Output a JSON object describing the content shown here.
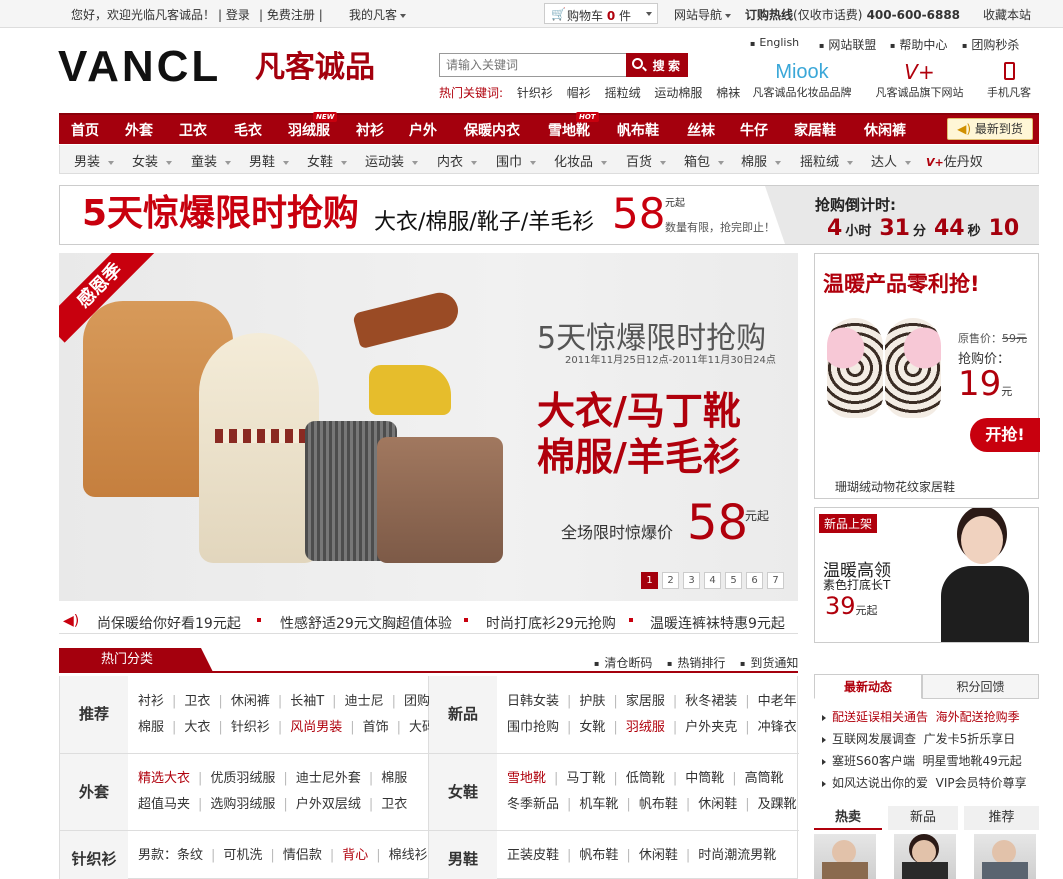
{
  "topbar": {
    "welcome": "您好，欢迎光临凡客诚品！",
    "login": "登录",
    "register": "免费注册",
    "my_vancl": "我的凡客",
    "cart_label": "购物车",
    "cart_count": "0",
    "cart_unit": "件",
    "site_nav": "网站导航",
    "hotline_label": "订购热线",
    "hotline_note": "(仅收市话费)",
    "hotline_number": "400-600-6888",
    "bookmark": "收藏本站"
  },
  "header": {
    "logo_en": "VANCL",
    "logo_cn": "凡客诚品",
    "search_placeholder": "请输入关键词",
    "search_button": "搜 索",
    "hot_keywords_label": "热门关键词:",
    "hot_keywords": [
      "针织衫",
      "帽衫",
      "摇粒绒",
      "运动棉服",
      "棉袜"
    ],
    "top_links": [
      "English",
      "网站联盟",
      "帮助中心",
      "团购秒杀"
    ],
    "brands": [
      {
        "logo": "Miook",
        "caption": "凡客诚品化妆品品牌"
      },
      {
        "logo": "V+",
        "caption": "凡客诚品旗下网站"
      },
      {
        "logo": "phone-icon",
        "caption": "手机凡客"
      }
    ]
  },
  "main_nav": {
    "items": [
      "首页",
      "外套",
      "卫衣",
      "毛衣",
      "羽绒服",
      "衬衫",
      "户外",
      "保暖内衣",
      "雪地靴",
      "帆布鞋",
      "丝袜",
      "牛仔",
      "家居鞋",
      "休闲裤"
    ],
    "tags": {
      "羽绒服": "NEW",
      "雪地靴": "HOT"
    },
    "new_arrivals": "最新到货"
  },
  "sub_nav": {
    "items": [
      "男装",
      "女装",
      "童装",
      "男鞋",
      "女鞋",
      "运动装",
      "内衣",
      "围巾",
      "化妆品",
      "百货",
      "箱包",
      "棉服",
      "摇粒绒",
      "达人",
      "佐丹奴"
    ]
  },
  "flash_sale": {
    "title": "5天惊爆限时抢购",
    "items": "大衣/棉服/靴子/羊毛衫",
    "price": "58",
    "price_suffix": "元起",
    "note": "数量有限，抢完即止！",
    "countdown_title": "抢购倒计时:",
    "countdown": {
      "hours": "4",
      "h_label": "小时",
      "minutes": "31",
      "m_label": "分",
      "seconds": "44",
      "s_label": "秒",
      "tenths": "10"
    }
  },
  "hero": {
    "ribbon": "感恩季",
    "title": "5天惊爆限时抢购",
    "dates": "2011年11月25日12点-2011年11月30日24点",
    "line1": "大衣/马丁靴",
    "line2": "棉服/羊毛衫",
    "price_label": "全场限时惊爆价",
    "price": "58",
    "price_suffix": "元起",
    "pages": [
      "1",
      "2",
      "3",
      "4",
      "5",
      "6",
      "7"
    ],
    "active_page": "1"
  },
  "ticker": {
    "items": [
      "尚保暖给你好看19元起",
      "性感舒适29元文胸超值体验",
      "时尚打底衫29元抢购",
      "温暖连裤袜特惠9元起"
    ]
  },
  "categories": {
    "header": "热门分类",
    "links": [
      "清仓断码",
      "热销排行",
      "到货通知"
    ],
    "rows": [
      {
        "left_label": "推荐",
        "left_line1": [
          "衬衫",
          "卫衣",
          "休闲裤",
          "长袖T",
          "迪士尼",
          "团购"
        ],
        "left_line2": [
          "棉服",
          "大衣",
          "针织衫",
          "风尚男装",
          "首饰",
          "大码"
        ],
        "right_label": "新品",
        "right_line1": [
          "日韩女装",
          "护肤",
          "家居服",
          "秋冬裙装",
          "中老年"
        ],
        "right_line2": [
          "围巾抢购",
          "女靴",
          "羽绒服",
          "户外夹克",
          "冲锋衣"
        ]
      },
      {
        "left_label": "外套",
        "left_line1": [
          "精选大衣",
          "优质羽绒服",
          "迪士尼外套",
          "棉服"
        ],
        "left_line2": [
          "超值马夹",
          "选购羽绒服",
          "户外双层绒",
          "卫衣"
        ],
        "right_label": "女鞋",
        "right_line1": [
          "雪地靴",
          "马丁靴",
          "低筒靴",
          "中筒靴",
          "高筒靴"
        ],
        "right_line2": [
          "冬季新品",
          "机车靴",
          "帆布鞋",
          "休闲鞋",
          "及踝靴"
        ]
      },
      {
        "left_label": "针织衫",
        "left_line1": [
          "男款：条纹",
          "可机洗",
          "情侣款",
          "背心",
          "棉线衫"
        ],
        "right_label": "男鞋",
        "right_line1": [
          "正装皮鞋",
          "帆布鞋",
          "休闲鞋",
          "时尚潮流男靴"
        ]
      }
    ]
  },
  "promo_warm": {
    "title": "温暖产品零利抢!",
    "original_label": "原售价：",
    "original_price": "59元",
    "grab_label": "抢购价：",
    "price": "19",
    "price_suffix": "元",
    "button": "开抢!",
    "caption": "珊瑚绒动物花纹家居鞋"
  },
  "promo_new": {
    "badge": "新品上架",
    "line1": "温暖高领",
    "line2": "素色打底长T",
    "price": "39",
    "price_suffix": "元起"
  },
  "news": {
    "tabs": [
      "最新动态",
      "积分回馈"
    ],
    "items": [
      {
        "a": "配送延误相关通告",
        "b": "海外配送抢购季",
        "red": true
      },
      {
        "a": "互联网发展调查",
        "b": "广发卡5折乐享日",
        "red": false
      },
      {
        "a": "塞班S60客户端",
        "b": "明星雪地靴49元起",
        "red": false
      },
      {
        "a": "如风达说出你的爱",
        "b": "VIP会员特价尊享",
        "red": false
      }
    ]
  },
  "hot_tabs": [
    "热卖",
    "新品",
    "推荐"
  ],
  "colors": {
    "brand": "#a4000d",
    "accent": "#c8000e"
  }
}
